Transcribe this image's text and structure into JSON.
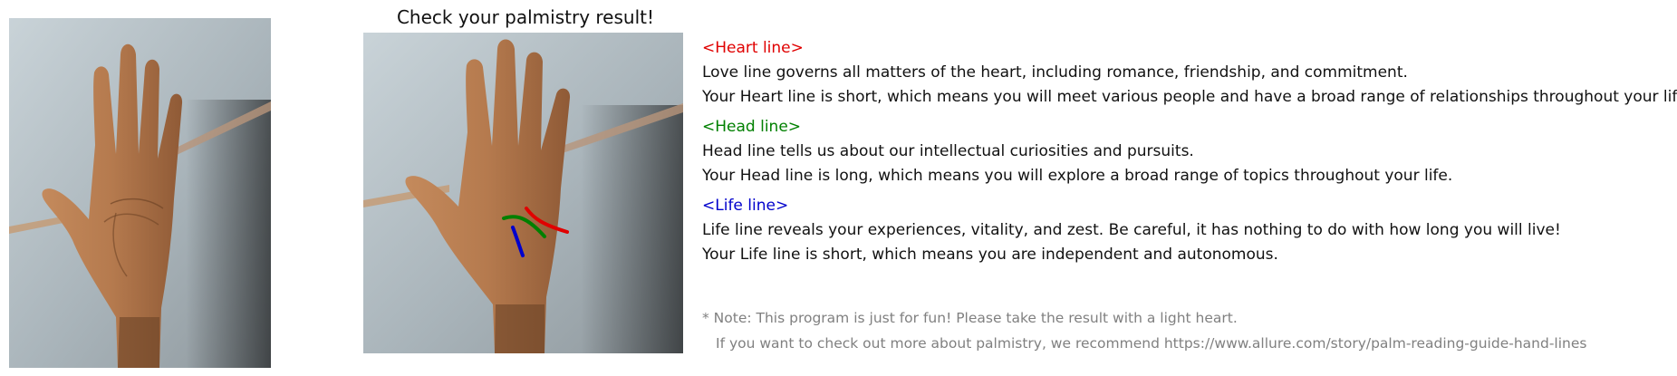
{
  "title": "Check your palmistry result!",
  "sections": [
    {
      "heading": "<Heart line>",
      "color": "#e00000",
      "description": "Love line governs all matters of the heart, including romance, friendship, and commitment.",
      "result": "Your Heart line is short, which means you will meet various people and have a broad range of relationships throughout your life."
    },
    {
      "heading": "<Head line>",
      "color": "#008000",
      "description": "Head line tells us about our intellectual curiosities and pursuits.",
      "result": "Your Head line is long, which means you will explore a broad range of topics throughout your life."
    },
    {
      "heading": "<Life line>",
      "color": "#0000cc",
      "description": "Life line reveals your experiences, vitality, and zest. Be careful, it has nothing to do with how long you will live!",
      "result": "Your Life line is short, which means you are independent and autonomous."
    }
  ],
  "note": {
    "line1": "* Note: This program is just for fun! Please take the result with a light heart.",
    "line2": "If you want to check out more about palmistry, we recommend https://www.allure.com/story/palm-reading-guide-hand-lines"
  },
  "colors": {
    "heart_line": "#e00000",
    "head_line": "#008000",
    "life_line": "#0000cc",
    "note_text": "#808080"
  }
}
